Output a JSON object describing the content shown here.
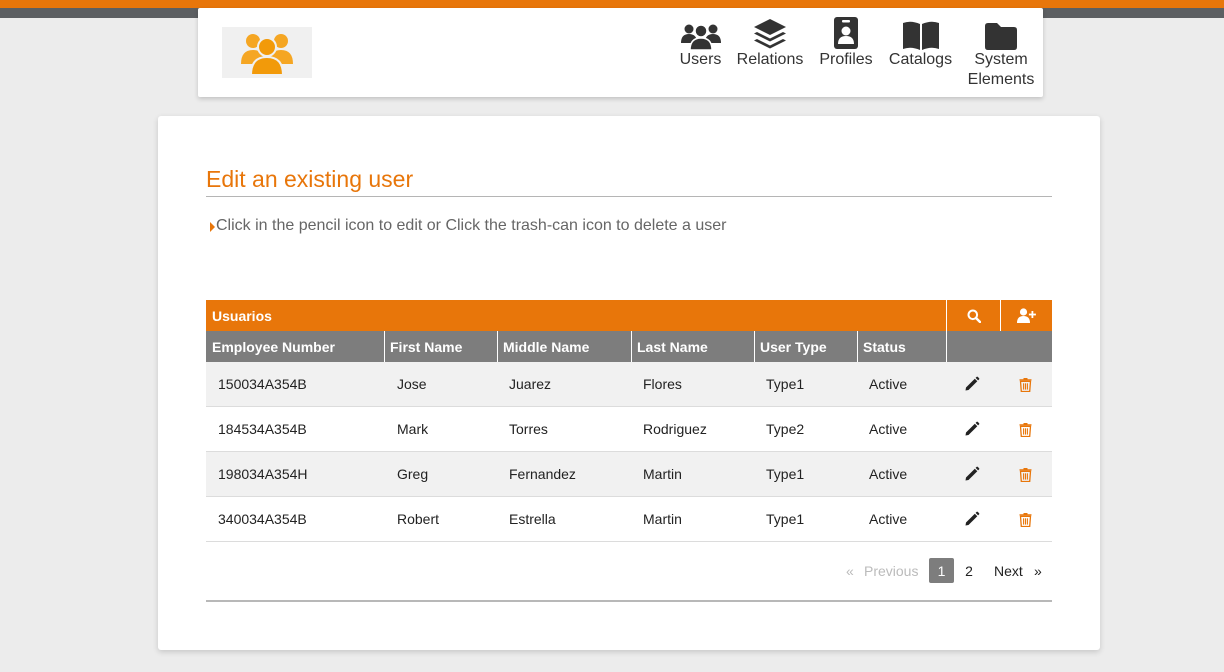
{
  "nav": {
    "items": [
      {
        "label": "Users",
        "icon": "users-icon"
      },
      {
        "label": "Relations",
        "icon": "layers-icon"
      },
      {
        "label": "Profiles",
        "icon": "id-badge-icon"
      },
      {
        "label": "Catalogs",
        "icon": "book-icon"
      },
      {
        "label": "System",
        "label2": "Elements",
        "icon": "folder-icon"
      }
    ]
  },
  "colors": {
    "accent": "#e8760a",
    "header_gray": "#7d7d7d",
    "topbar": "#5c5f62"
  },
  "page": {
    "title": "Edit an existing user",
    "instruction": "Click in the pencil icon to edit or Click the trash-can icon to delete a user"
  },
  "table": {
    "title": "Usuarios",
    "columns": [
      "Employee Number",
      "First Name",
      "Middle Name",
      "Last Name",
      "User Type",
      "Status"
    ],
    "rows": [
      [
        "150034A354B",
        "Jose",
        "Juarez",
        "Flores",
        "Type1",
        "Active"
      ],
      [
        "184534A354B",
        "Mark",
        "Torres",
        "Rodriguez",
        "Type2",
        "Active"
      ],
      [
        "198034A354H",
        "Greg",
        "Fernandez",
        "Martin",
        "Type1",
        "Active"
      ],
      [
        "340034A354B",
        "Robert",
        "Estrella",
        "Martin",
        "Type1",
        "Active"
      ]
    ]
  },
  "pagination": {
    "prev_symbol": "«",
    "previous": "Previous",
    "pages": [
      "1",
      "2"
    ],
    "current": "1",
    "next": "Next",
    "next_symbol": "»"
  }
}
